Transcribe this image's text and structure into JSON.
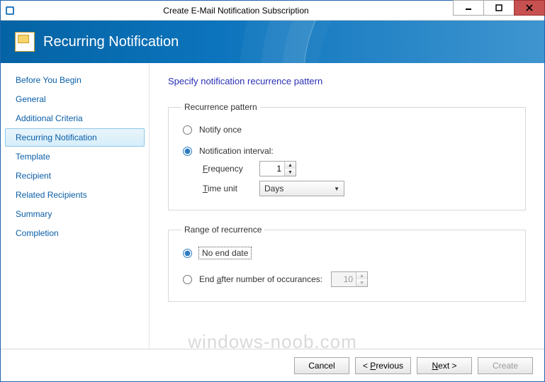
{
  "window": {
    "title": "Create E-Mail Notification Subscription"
  },
  "banner": {
    "title": "Recurring Notification"
  },
  "sidebar": {
    "items": [
      {
        "label": "Before You Begin"
      },
      {
        "label": "General"
      },
      {
        "label": "Additional Criteria"
      },
      {
        "label": "Recurring Notification"
      },
      {
        "label": "Template"
      },
      {
        "label": "Recipient"
      },
      {
        "label": "Related Recipients"
      },
      {
        "label": "Summary"
      },
      {
        "label": "Completion"
      }
    ],
    "selected_index": 3
  },
  "content": {
    "heading": "Specify notification recurrence pattern",
    "recurrence_group_label": "Recurrence pattern",
    "notify_once_label": "Notify once",
    "notification_interval_label": "Notification interval:",
    "frequency_label": "Frequency",
    "frequency_value": "1",
    "time_unit_label": "Time unit",
    "time_unit_value": "Days",
    "range_group_label": "Range of recurrence",
    "no_end_label": "No end date",
    "end_after_label": "End after number of occurances:",
    "end_after_value": "10",
    "recurrence_selected": "interval",
    "range_selected": "no_end"
  },
  "footer": {
    "cancel": "Cancel",
    "previous": "< Previous",
    "next": "Next >",
    "create": "Create"
  },
  "watermark": "windows-noob.com"
}
